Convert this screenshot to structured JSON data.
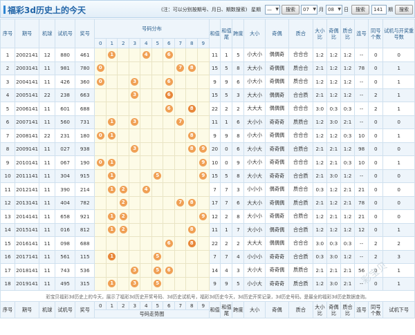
{
  "header": {
    "title": "福彩3d历史上的今天",
    "note": "(注：可以分别按期号、月日、期数搜索)",
    "week_label": "星期",
    "week_value": "—",
    "month_value": "07",
    "month_label": "月",
    "day_value": "08",
    "day_label": "日",
    "search_label": "搜索",
    "count_value": "141",
    "period_label": "期"
  },
  "columns": {
    "seq": "序号",
    "issue": "期号",
    "sort": "排序",
    "machine": "机球",
    "trial": "试机号",
    "prize": "奖号",
    "distribution": "号码分布",
    "sum": "和值",
    "sum_tail": "和值尾",
    "span": "跨度",
    "size": "大小",
    "odd_even": "奇偶",
    "prime": "质合",
    "size_ratio": "大小比",
    "oe_ratio": "奇偶比",
    "prime_ratio": "质合比",
    "consecutive": "连号",
    "same": "同号个数",
    "trial_open": "试机与开奖重号数",
    "trial_next": "试机下号",
    "digits": [
      "0",
      "1",
      "2",
      "3",
      "4",
      "5",
      "6",
      "7",
      "8",
      "9"
    ],
    "trend_label": "号码走势图"
  },
  "rows": [
    {
      "seq": "1",
      "issue": "2002141",
      "machine": "12",
      "trial": "880",
      "prize": "461",
      "balls": [
        1,
        4,
        6
      ],
      "dual": [],
      "sum": "11",
      "tail": "1",
      "span": "5",
      "size": "小大小",
      "oe": "偶偶奇",
      "prime": "合合合",
      "sr": "1:2",
      "or": "1:2",
      "pr": "1:2",
      "lh": "--",
      "same": "0",
      "rep": "0"
    },
    {
      "seq": "2",
      "issue": "2003141",
      "machine": "11",
      "trial": "981",
      "prize": "780",
      "balls": [
        0,
        7,
        8
      ],
      "dual": [],
      "sum": "15",
      "tail": "5",
      "span": "8",
      "size": "大大小",
      "oe": "奇偶偶",
      "prime": "质合合",
      "sr": "2:1",
      "or": "1:2",
      "pr": "1:2",
      "lh": "78",
      "same": "0",
      "rep": "1"
    },
    {
      "seq": "3",
      "issue": "2004141",
      "machine": "11",
      "trial": "426",
      "prize": "360",
      "balls": [
        0,
        3,
        6
      ],
      "dual": [],
      "sum": "9",
      "tail": "9",
      "span": "6",
      "size": "小大小",
      "oe": "奇偶偶",
      "prime": "质合合",
      "sr": "1:2",
      "or": "1:2",
      "pr": "1:2",
      "lh": "--",
      "same": "0",
      "rep": "1"
    },
    {
      "seq": "4",
      "issue": "2005141",
      "machine": "22",
      "trial": "238",
      "prize": "663",
      "balls": [
        3,
        6
      ],
      "dual": [
        6
      ],
      "sum": "15",
      "tail": "5",
      "span": "3",
      "size": "大大小",
      "oe": "偶偶奇",
      "prime": "合合质",
      "sr": "2:1",
      "or": "1:2",
      "pr": "1:2",
      "lh": "--",
      "same": "2",
      "rep": "1"
    },
    {
      "seq": "5",
      "issue": "2006141",
      "machine": "11",
      "trial": "601",
      "prize": "688",
      "balls": [
        6,
        8
      ],
      "dual": [
        8
      ],
      "sum": "22",
      "tail": "2",
      "span": "2",
      "size": "大大大",
      "oe": "偶偶偶",
      "prime": "合合合",
      "sr": "3:0",
      "or": "0:3",
      "pr": "0:3",
      "lh": "--",
      "same": "2",
      "rep": "1"
    },
    {
      "seq": "6",
      "issue": "2007141",
      "machine": "11",
      "trial": "560",
      "prize": "731",
      "balls": [
        1,
        3,
        7
      ],
      "dual": [],
      "sum": "11",
      "tail": "1",
      "span": "6",
      "size": "大小小",
      "oe": "奇奇奇",
      "prime": "质质合",
      "sr": "1:2",
      "or": "3:0",
      "pr": "2:1",
      "lh": "--",
      "same": "0",
      "rep": "0"
    },
    {
      "seq": "7",
      "issue": "2008141",
      "machine": "22",
      "trial": "231",
      "prize": "180",
      "balls": [
        0,
        1,
        8
      ],
      "dual": [],
      "sum": "9",
      "tail": "9",
      "span": "8",
      "size": "小大小",
      "oe": "奇偶偶",
      "prime": "合合合",
      "sr": "1:2",
      "or": "1:2",
      "pr": "0:3",
      "lh": "10",
      "same": "0",
      "rep": "1"
    },
    {
      "seq": "8",
      "issue": "2009141",
      "machine": "11",
      "trial": "027",
      "prize": "938",
      "balls": [
        3,
        8,
        9
      ],
      "dual": [],
      "sum": "20",
      "tail": "0",
      "span": "6",
      "size": "大小大",
      "oe": "奇奇偶",
      "prime": "合质合",
      "sr": "2:1",
      "or": "2:1",
      "pr": "1:2",
      "lh": "98",
      "same": "0",
      "rep": "0"
    },
    {
      "seq": "9",
      "issue": "2010141",
      "machine": "11",
      "trial": "067",
      "prize": "190",
      "balls": [
        0,
        1,
        9
      ],
      "dual": [],
      "sum": "10",
      "tail": "0",
      "span": "9",
      "size": "小大小",
      "oe": "奇奇偶",
      "prime": "合合合",
      "sr": "1:2",
      "or": "2:1",
      "pr": "0:3",
      "lh": "10",
      "same": "0",
      "rep": "1"
    },
    {
      "seq": "10",
      "issue": "2011141",
      "machine": "11",
      "trial": "304",
      "prize": "915",
      "balls": [
        1,
        5,
        9
      ],
      "dual": [],
      "sum": "15",
      "tail": "5",
      "span": "8",
      "size": "大小大",
      "oe": "奇奇奇",
      "prime": "合合质",
      "sr": "2:1",
      "or": "3:0",
      "pr": "1:2",
      "lh": "--",
      "same": "0",
      "rep": "0"
    },
    {
      "seq": "11",
      "issue": "2012141",
      "machine": "11",
      "trial": "390",
      "prize": "214",
      "balls": [
        1,
        2,
        4
      ],
      "dual": [],
      "sum": "7",
      "tail": "7",
      "span": "3",
      "size": "小小小",
      "oe": "偶奇偶",
      "prime": "质合合",
      "sr": "0:3",
      "or": "1:2",
      "pr": "2:1",
      "lh": "21",
      "same": "0",
      "rep": "0"
    },
    {
      "seq": "12",
      "issue": "2013141",
      "machine": "11",
      "trial": "404",
      "prize": "782",
      "balls": [
        2,
        7,
        8
      ],
      "dual": [],
      "sum": "17",
      "tail": "7",
      "span": "6",
      "size": "大大小",
      "oe": "奇偶偶",
      "prime": "质合质",
      "sr": "2:1",
      "or": "1:2",
      "pr": "2:1",
      "lh": "78",
      "same": "0",
      "rep": "0"
    },
    {
      "seq": "13",
      "issue": "2014141",
      "machine": "11",
      "trial": "658",
      "prize": "921",
      "balls": [
        1,
        2,
        9
      ],
      "dual": [],
      "sum": "12",
      "tail": "2",
      "span": "8",
      "size": "大小小",
      "oe": "奇偶奇",
      "prime": "合质合",
      "sr": "1:2",
      "or": "2:1",
      "pr": "1:2",
      "lh": "21",
      "same": "0",
      "rep": "0"
    },
    {
      "seq": "14",
      "issue": "2015141",
      "machine": "11",
      "trial": "016",
      "prize": "812",
      "balls": [
        1,
        2,
        8
      ],
      "dual": [],
      "sum": "11",
      "tail": "1",
      "span": "7",
      "size": "大小小",
      "oe": "偶奇偶",
      "prime": "合合质",
      "sr": "1:2",
      "or": "1:2",
      "pr": "1:2",
      "lh": "12",
      "same": "0",
      "rep": "1"
    },
    {
      "seq": "15",
      "issue": "2016141",
      "machine": "11",
      "trial": "098",
      "prize": "688",
      "balls": [
        6,
        8
      ],
      "dual": [
        8
      ],
      "sum": "22",
      "tail": "2",
      "span": "2",
      "size": "大大大",
      "oe": "偶偶偶",
      "prime": "合合合",
      "sr": "3:0",
      "or": "0:3",
      "pr": "0:3",
      "lh": "--",
      "same": "2",
      "rep": "2"
    },
    {
      "seq": "16",
      "issue": "2017141",
      "machine": "11",
      "trial": "561",
      "prize": "115",
      "balls": [
        1,
        5
      ],
      "dual": [
        1
      ],
      "sum": "7",
      "tail": "7",
      "span": "4",
      "size": "小小小",
      "oe": "奇奇奇",
      "prime": "合合质",
      "sr": "0:3",
      "or": "3:0",
      "pr": "1:2",
      "lh": "--",
      "same": "2",
      "rep": "3"
    },
    {
      "seq": "17",
      "issue": "2018141",
      "machine": "11",
      "trial": "743",
      "prize": "536",
      "balls": [
        3,
        5,
        6
      ],
      "dual": [],
      "sum": "14",
      "tail": "4",
      "span": "3",
      "size": "大小大",
      "oe": "奇奇偶",
      "prime": "质质合",
      "sr": "2:1",
      "or": "2:1",
      "pr": "2:1",
      "lh": "56",
      "same": "0",
      "rep": "1"
    },
    {
      "seq": "18",
      "issue": "2019141",
      "machine": "11",
      "trial": "495",
      "prize": "315",
      "balls": [
        1,
        3,
        5
      ],
      "dual": [],
      "sum": "9",
      "tail": "9",
      "span": "5",
      "size": "小小大",
      "oe": "奇奇奇",
      "prime": "质合质",
      "sr": "1:2",
      "or": "3:0",
      "pr": "2:1",
      "lh": "--",
      "same": "0",
      "rep": "1"
    }
  ],
  "footnote": "彩宝贝福彩3d历史上的今天，展示了福彩3d历史开奖号码、3d历史试机号，福彩3d历史今天，3d历史开奖记录，3d历史号码，是最全的福彩3d历史数据查询。",
  "watermark": "彩宝贝"
}
